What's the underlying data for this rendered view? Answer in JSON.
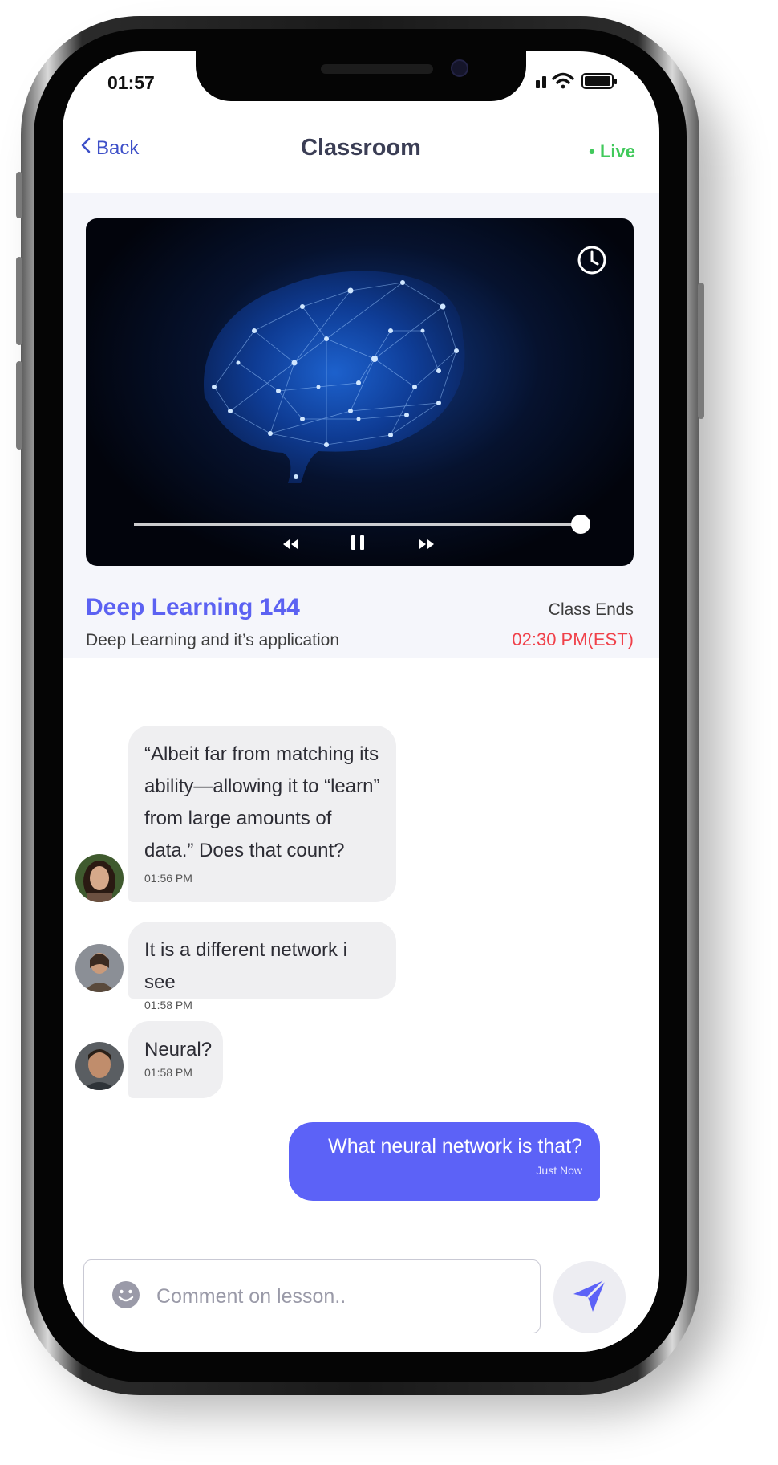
{
  "status_bar": {
    "time": "01:57"
  },
  "nav": {
    "back_label": "Back",
    "title": "Classroom",
    "live_label": "• Live"
  },
  "course": {
    "title": "Deep Learning 144",
    "subtitle": "Deep Learning and it’s application",
    "ends_label": "Class Ends",
    "ends_time": "02:30 PM(EST)"
  },
  "video": {
    "progress": 0.99,
    "controls": [
      "rewind-icon",
      "pause-icon",
      "fast-forward-icon"
    ]
  },
  "messages": [
    {
      "text": "“Albeit far from matching its ability—allowing it to “learn” from large amounts of data.” Does that count?",
      "time": "01:56 PM",
      "sender": "other"
    },
    {
      "text": "It is a different network i see",
      "time": "01:58 PM",
      "sender": "other"
    },
    {
      "text": "Neural?",
      "time": "01:58 PM",
      "sender": "other"
    },
    {
      "text": "What neural network is that?",
      "time": "Just Now",
      "sender": "me"
    }
  ],
  "composer": {
    "placeholder": "Comment on lesson.."
  },
  "colors": {
    "accent": "#5c62f7",
    "live": "#41c95b",
    "danger": "#f0414a",
    "link": "#3e50c8"
  }
}
